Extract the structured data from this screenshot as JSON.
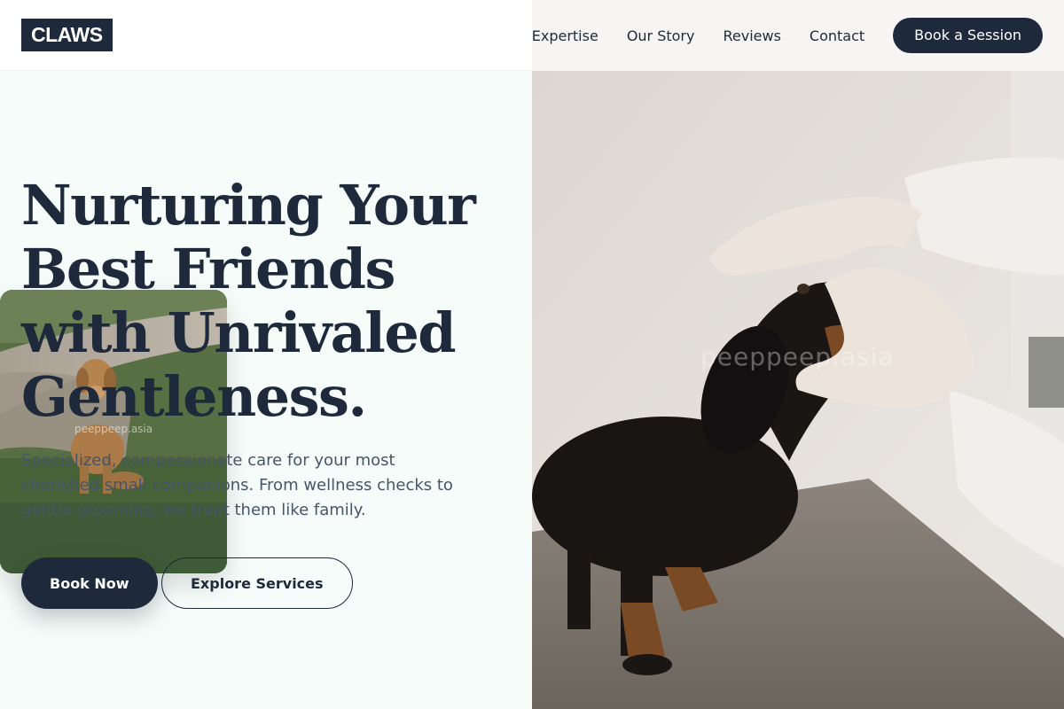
{
  "brand": {
    "logo": "CLAWS"
  },
  "nav": {
    "links": [
      "Expertise",
      "Our Story",
      "Reviews",
      "Contact"
    ],
    "cta": "Book a Session"
  },
  "hero": {
    "headline": "Nurturing Your Best Friends with Unrivaled Gentleness.",
    "subtext": "Specialized, compassionate care for your most cherished small companions. From wellness checks to gentle grooming, we treat them like family.",
    "primary_button": "Book Now",
    "secondary_button": "Explore Services"
  },
  "images": {
    "card_watermark": "peeppeep.asia",
    "photo_watermark": "peeppeep.asia"
  },
  "colors": {
    "primary": "#1e293b",
    "hero_bg": "#f5fcf9",
    "text_muted": "#475569"
  }
}
